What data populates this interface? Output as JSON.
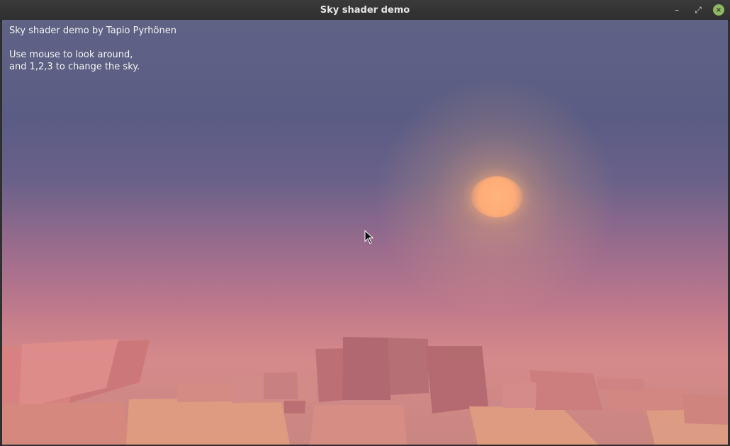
{
  "window": {
    "title": "Sky shader demo",
    "controls": {
      "minimize_glyph": "–",
      "maximize_glyph": "⤢",
      "close_glyph": "×"
    }
  },
  "overlay": {
    "line1": "Sky shader demo by Tapio Pyrhönen",
    "line2": "",
    "line3": "Use mouse to look around,",
    "line4": "and 1,2,3 to change the sky."
  },
  "colors": {
    "titlebar": "#2f2f2f",
    "sky_top": "#5f6285",
    "sky_horizon": "#d68a8e",
    "sun": "#ffb47a",
    "close_button": "#8fb866"
  },
  "icons": {
    "cursor": "mouse-pointer-icon"
  }
}
